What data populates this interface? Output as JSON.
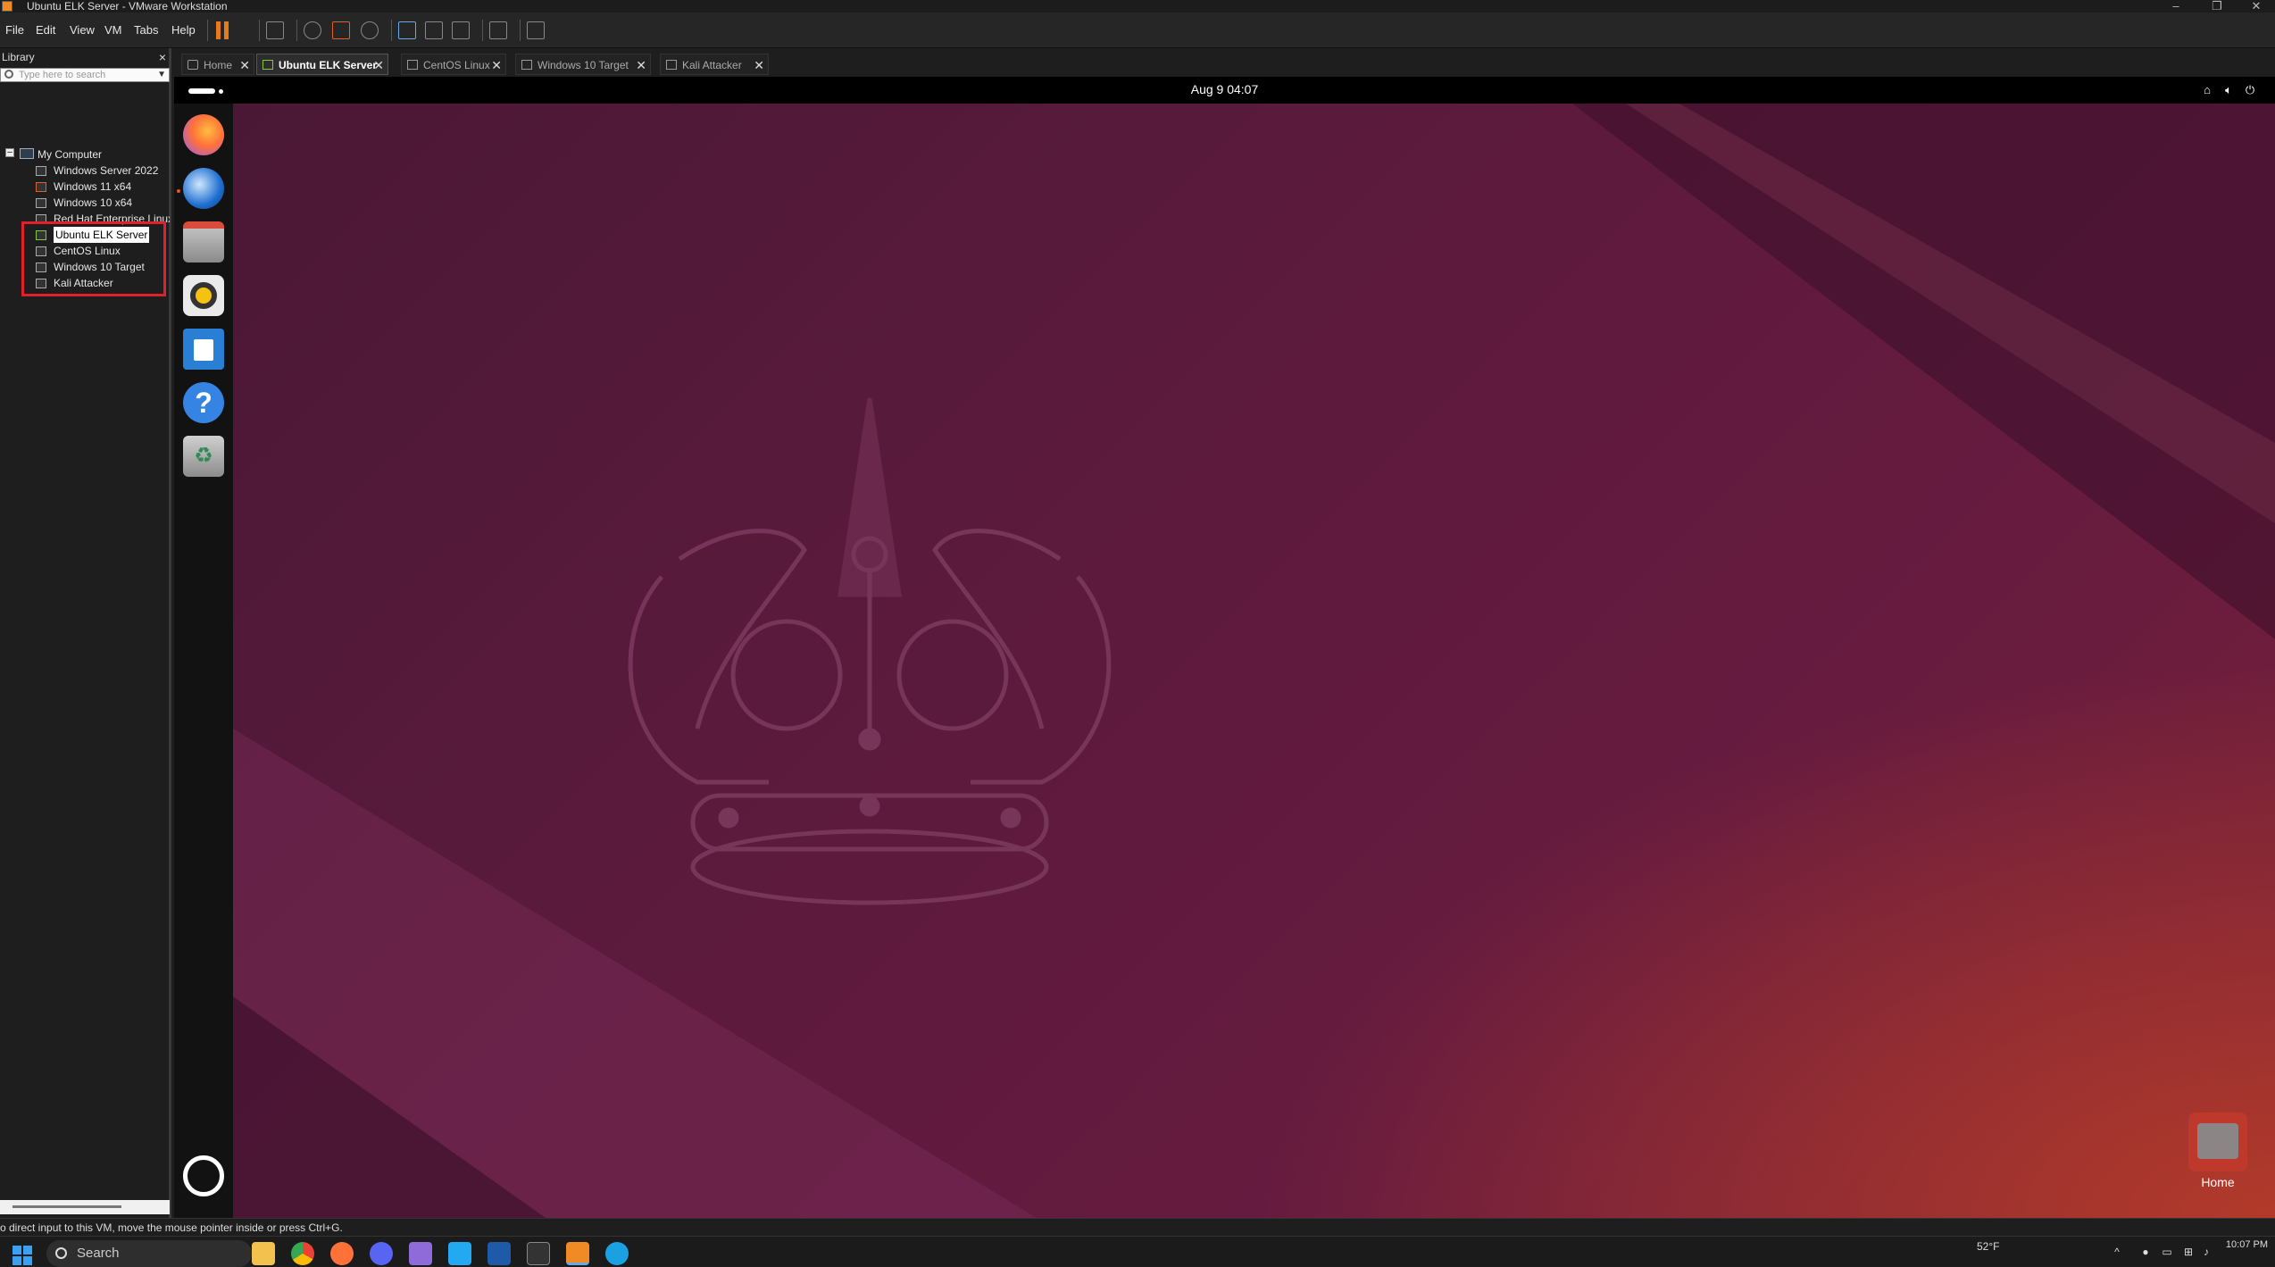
{
  "window": {
    "title": "Ubuntu ELK Server - VMware Workstation",
    "minimize": "–",
    "restore": "❐",
    "close": "✕"
  },
  "menu": [
    "File",
    "Edit",
    "View",
    "VM",
    "Tabs",
    "Help"
  ],
  "library": {
    "title": "Library",
    "close": "×",
    "search_placeholder": "Type here to search",
    "root": "My Computer",
    "root_expander": "–",
    "items": [
      {
        "label": "Windows Server 2022",
        "selected": false
      },
      {
        "label": "Windows 11 x64",
        "selected": false
      },
      {
        "label": "Windows 10 x64",
        "selected": false
      },
      {
        "label": "Red Hat Enterprise Linux",
        "selected": false
      },
      {
        "label": "Ubuntu ELK Server",
        "selected": true
      },
      {
        "label": "CentOS Linux",
        "selected": false
      },
      {
        "label": "Windows 10 Target",
        "selected": false
      },
      {
        "label": "Kali Attacker",
        "selected": false
      }
    ]
  },
  "tabs": [
    {
      "label": "Home",
      "active": false
    },
    {
      "label": "Ubuntu ELK Server",
      "active": true
    },
    {
      "label": "CentOS Linux",
      "active": false
    },
    {
      "label": "Windows 10 Target",
      "active": false
    },
    {
      "label": "Kali Attacker",
      "active": false
    }
  ],
  "tab_close": "✕",
  "vm": {
    "clock": "Aug 9  04:07",
    "dock_apps": [
      {
        "name": "firefox-icon",
        "color": "#ff7139"
      },
      {
        "name": "thunderbird-icon",
        "color": "#1f6fd0"
      },
      {
        "name": "files-icon",
        "color": "#9a9a9a"
      },
      {
        "name": "rhythmbox-icon",
        "color": "#f5c211"
      },
      {
        "name": "writer-icon",
        "color": "#2a7fd4"
      },
      {
        "name": "help-icon",
        "color": "#3584e4"
      },
      {
        "name": "trash-icon",
        "color": "#8c8c8c"
      }
    ],
    "help_glyph": "?",
    "trash_glyph": "♻",
    "desktop_icon_label": "Home"
  },
  "statusbar": {
    "message": "o direct input to this VM, move the mouse pointer inside or press Ctrl+G."
  },
  "taskbar": {
    "search_label": "Search",
    "weather_temp": "52°F",
    "time": "10:07 PM"
  }
}
